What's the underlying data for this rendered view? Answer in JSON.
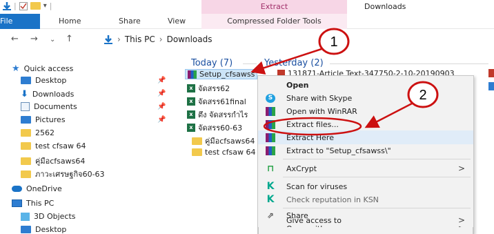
{
  "ribbon": {
    "contextual_group": "Extract",
    "window_title": "Downloads",
    "tabs": [
      "File",
      "Home",
      "Share",
      "View",
      "Compressed Folder Tools"
    ]
  },
  "address": {
    "crumbs": [
      "This PC",
      "Downloads"
    ]
  },
  "sidebar": {
    "quick_access": "Quick access",
    "items": [
      "Desktop",
      "Downloads",
      "Documents",
      "Pictures",
      "2562",
      "test cfsaw 64",
      "คู่มือcfsaws64",
      "ภาวะเศรษฐกิจ60-63"
    ],
    "onedrive": "OneDrive",
    "this_pc": "This PC",
    "pc_items": [
      "3D Objects",
      "Desktop"
    ]
  },
  "files": {
    "today_header": "Today (7)",
    "yesterday_header": "Yesterday (2)",
    "today": [
      "Setup_cfsawss",
      "จัดสรร62",
      "จัดสรร61final",
      "ตึง จัดสรรกำไร",
      "จัดสรร60-63",
      "คู่มือcfsaws64",
      "test cfsaw 64"
    ],
    "yesterday": [
      "131871-Article Text-347750-2-10-20190903"
    ]
  },
  "context_menu": {
    "items": [
      {
        "label": "Open",
        "bold": true
      },
      {
        "label": "Share with Skype"
      },
      {
        "label": "Open with WinRAR"
      },
      {
        "label": "Extract files..."
      },
      {
        "label": "Extract Here"
      },
      {
        "label": "Extract to \"Setup_cfsawss\\\""
      },
      {
        "label": "AxCrypt",
        "submenu": ">"
      },
      {
        "label": "Scan for viruses"
      },
      {
        "label": "Check reputation in KSN"
      },
      {
        "label": "Share"
      },
      {
        "label": "Open with",
        "submenu": ">"
      },
      {
        "label": "Give access to",
        "submenu": ">"
      }
    ]
  },
  "annotations": {
    "step1": "1",
    "step2": "2",
    "color": "#cc1111"
  }
}
